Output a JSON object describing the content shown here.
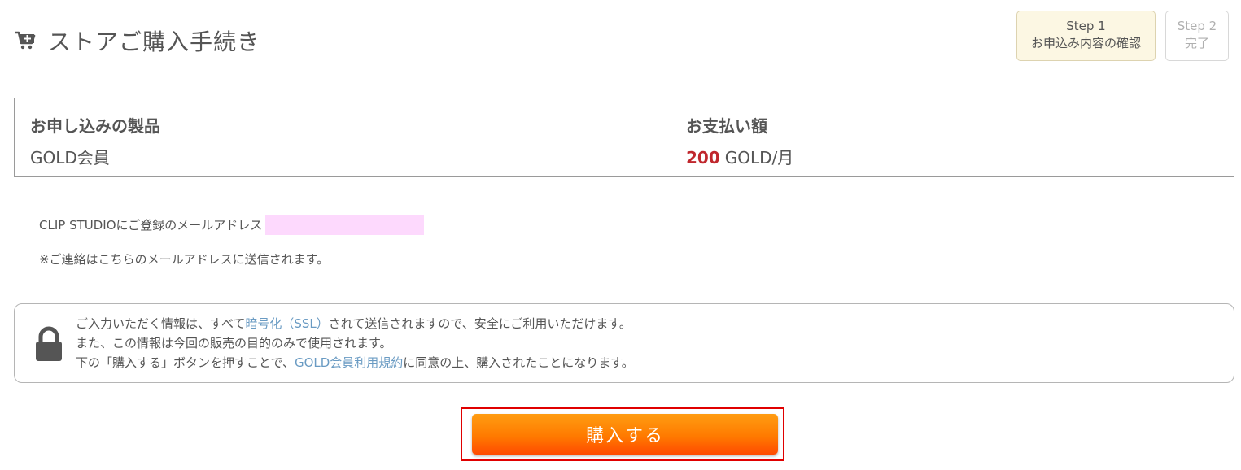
{
  "header": {
    "title": "ストアご購入手続き",
    "icon": "cart-plus-icon"
  },
  "steps": [
    {
      "line1": "Step 1",
      "line2": "お申込み内容の確認",
      "state": "active"
    },
    {
      "line1": "Step 2",
      "line2": "完了",
      "state": "inactive"
    }
  ],
  "order": {
    "product_heading": "お申し込みの製品",
    "product_value": "GOLD会員",
    "payment_heading": "お支払い額",
    "payment_amount": "200",
    "payment_unit": "GOLD/月",
    "price_color": "#c0272d"
  },
  "email": {
    "label": "CLIP STUDIOにご登録のメールアドレス",
    "notice": "※ご連絡はこちらのメールアドレスに送信されます。"
  },
  "security": {
    "icon": "lock-icon",
    "line1_prefix": "ご入力いただく情報は、すべて",
    "line1_link": "暗号化（SSL）",
    "line1_suffix": "されて送信されますので、安全にご利用いただけます。",
    "line2": "また、この情報は今回の販売の目的のみで使用されます。",
    "line3_prefix": "下の「購入する」ボタンを押すことで、",
    "line3_link": "GOLD会員利用規約",
    "line3_suffix": "に同意の上、購入されたことになります。"
  },
  "purchase_button": {
    "label": "購入する",
    "color": "#ff7a00"
  }
}
